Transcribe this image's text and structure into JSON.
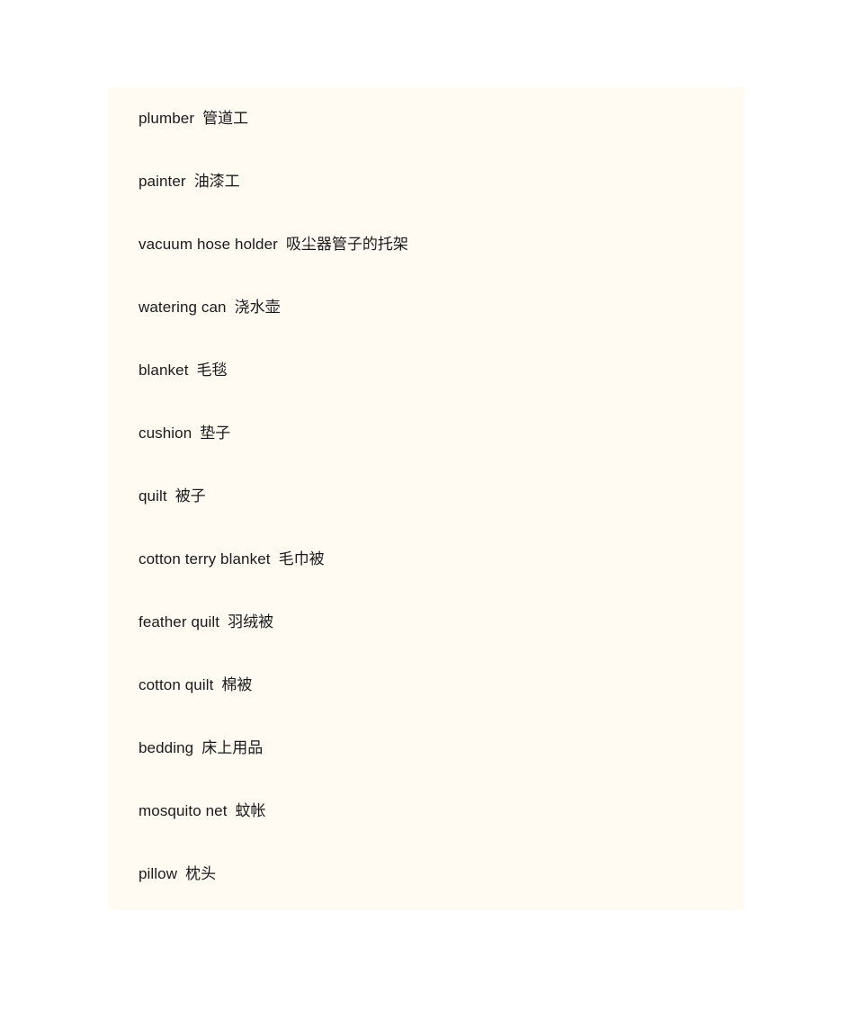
{
  "page": {
    "background_color": "#ffffff",
    "panel_background_color": "#fffbf2",
    "text_color": "#1a1a1a"
  },
  "vocab": {
    "entries": [
      {
        "en": "plumber",
        "zh": "管道工"
      },
      {
        "en": "painter",
        "zh": "油漆工"
      },
      {
        "en": "vacuum hose holder",
        "zh": "吸尘器管子的托架"
      },
      {
        "en": "watering can",
        "zh": "浇水壶"
      },
      {
        "en": "blanket",
        "zh": "毛毯"
      },
      {
        "en": "cushion",
        "zh": "垫子"
      },
      {
        "en": "quilt",
        "zh": "被子"
      },
      {
        "en": "cotton terry blanket",
        "zh": "毛巾被"
      },
      {
        "en": "feather quilt",
        "zh": "羽绒被"
      },
      {
        "en": "cotton quilt",
        "zh": "棉被"
      },
      {
        "en": "bedding",
        "zh": "床上用品"
      },
      {
        "en": "mosquito net",
        "zh": "蚊帐"
      },
      {
        "en": "pillow",
        "zh": "枕头"
      }
    ]
  }
}
